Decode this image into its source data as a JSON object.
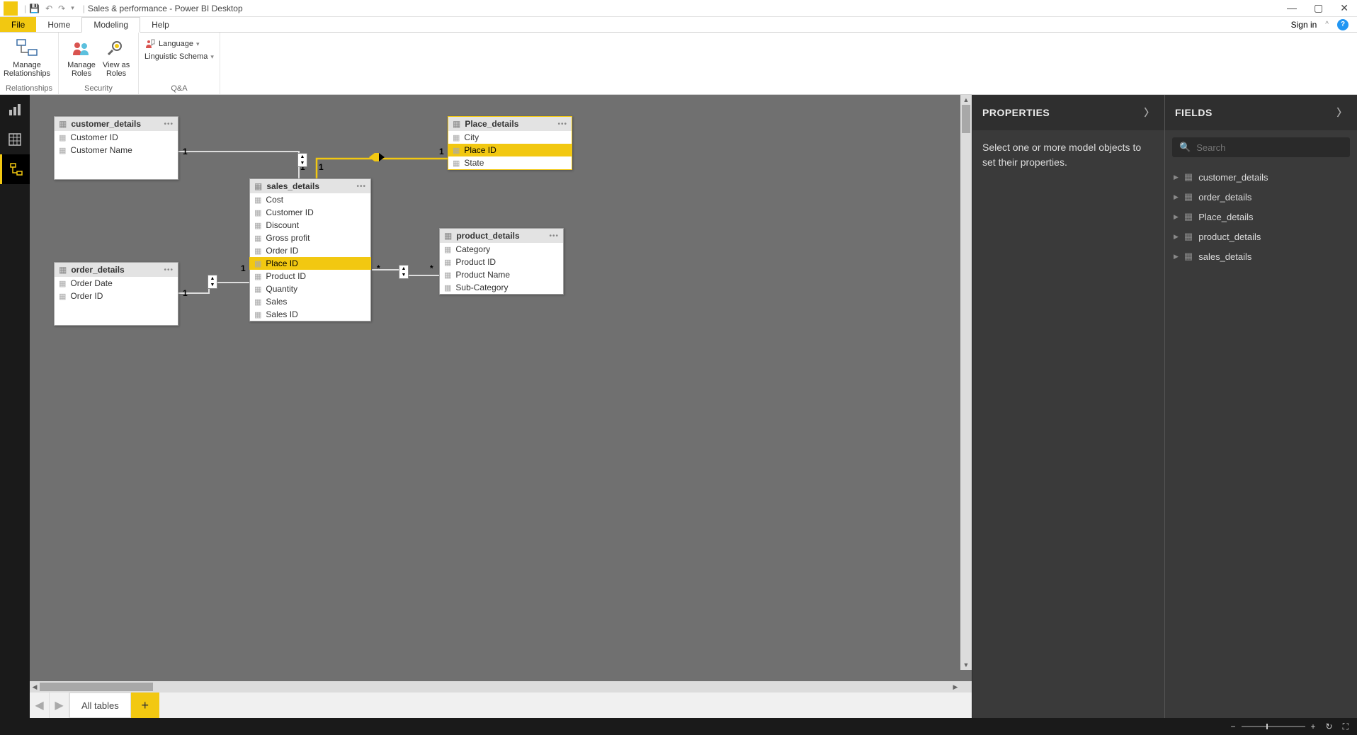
{
  "titlebar": {
    "title": "Sales & performance - Power BI Desktop"
  },
  "ribbon_tabs": {
    "file": "File",
    "home": "Home",
    "modeling": "Modeling",
    "help": "Help",
    "signin": "Sign in"
  },
  "ribbon": {
    "relationships": {
      "manage": "Manage\nRelationships",
      "group": "Relationships"
    },
    "security": {
      "manage_roles": "Manage\nRoles",
      "view_as": "View as\nRoles",
      "group": "Security"
    },
    "qa": {
      "language": "Language",
      "schema": "Linguistic Schema",
      "group": "Q&A"
    }
  },
  "tables": {
    "customer_details": {
      "name": "customer_details",
      "fields": [
        "Customer ID",
        "Customer Name"
      ]
    },
    "order_details": {
      "name": "order_details",
      "fields": [
        "Order Date",
        "Order ID"
      ]
    },
    "sales_details": {
      "name": "sales_details",
      "fields": [
        "Cost",
        "Customer ID",
        "Discount",
        "Gross profit",
        "Order ID",
        "Place ID",
        "Product ID",
        "Quantity",
        "Sales",
        "Sales ID"
      ]
    },
    "place_details": {
      "name": "Place_details",
      "fields": [
        "City",
        "Place ID",
        "State"
      ]
    },
    "product_details": {
      "name": "product_details",
      "fields": [
        "Category",
        "Product ID",
        "Product Name",
        "Sub-Category"
      ]
    }
  },
  "cardinality": {
    "one": "1",
    "many": "*"
  },
  "bottom_tabs": {
    "all": "All tables"
  },
  "properties": {
    "title": "PROPERTIES",
    "placeholder": "Select one or more model objects to set their properties."
  },
  "fields_panel": {
    "title": "FIELDS",
    "search_placeholder": "Search",
    "items": [
      "customer_details",
      "order_details",
      "Place_details",
      "product_details",
      "sales_details"
    ]
  }
}
